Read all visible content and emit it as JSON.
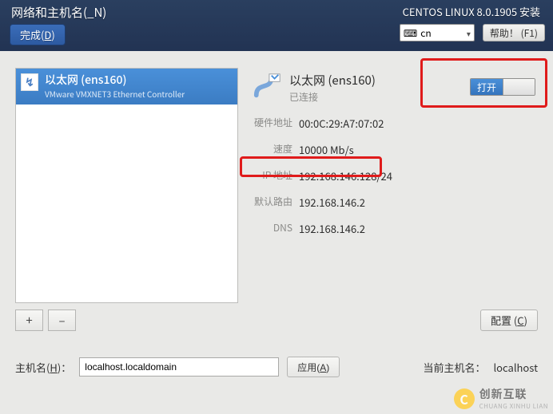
{
  "header": {
    "page_title": "网络和主机名(_N)",
    "done_label_prefix": "完成(",
    "done_mnemonic": "D",
    "done_label_suffix": ")",
    "distro": "CENTOS LINUX 8.0.1905 安装",
    "lang_code": "cn",
    "help_label": "帮助！  (F1)"
  },
  "device_list": {
    "items": [
      {
        "name": "以太网 (ens160)",
        "subtitle": "VMware VMXNET3 Ethernet Controller"
      }
    ],
    "add_label": "+",
    "remove_label": "–"
  },
  "details": {
    "title": "以太网 (ens160)",
    "status": "已连接",
    "rows": {
      "hw_label": "硬件地址",
      "hw_val": "00:0C:29:A7:07:02",
      "speed_label": "速度",
      "speed_val": "10000 Mb/s",
      "ip_label": "IP 地址",
      "ip_val": "192.168.146.128/24",
      "gw_label": "默认路由",
      "gw_val": "192.168.146.2",
      "dns_label": "DNS",
      "dns_val": "192.168.146.2"
    }
  },
  "toggle": {
    "on_label": "打开"
  },
  "configure": {
    "label_prefix": "配置 (",
    "mnemonic": "C",
    "label_suffix": ")"
  },
  "hostname": {
    "label_prefix": "主机名(",
    "mnemonic": "H",
    "label_suffix": ")：",
    "value": "localhost.localdomain",
    "apply_prefix": "应用(",
    "apply_mnemonic": "A",
    "apply_suffix": ")",
    "current_label": "当前主机名：",
    "current_value": "localhost"
  },
  "watermark": {
    "cn": "创新互联",
    "en": "CHUANG XINHU LIAN"
  }
}
